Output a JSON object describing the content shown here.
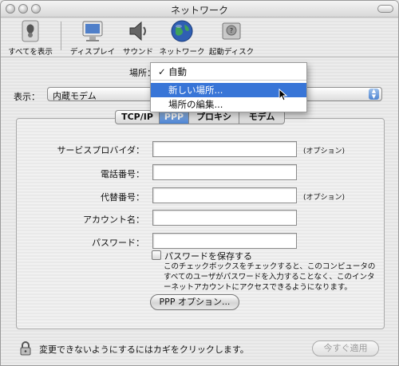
{
  "window": {
    "title": "ネットワーク"
  },
  "toolbar": {
    "items": [
      {
        "label": "すべてを表示",
        "icon": "show-all-icon"
      },
      {
        "label": "ディスプレイ",
        "icon": "display-icon"
      },
      {
        "label": "サウンド",
        "icon": "sound-icon"
      },
      {
        "label": "ネットワーク",
        "icon": "network-globe-icon"
      },
      {
        "label": "起動ディスク",
        "icon": "startup-disk-icon"
      }
    ]
  },
  "location": {
    "label": "場所：",
    "menu": {
      "current": "自動",
      "items": [
        "新しい場所...",
        "場所の編集..."
      ],
      "highlighted": "新しい場所..."
    }
  },
  "show": {
    "label": "表示：",
    "value": "内蔵モデム"
  },
  "tabs": [
    "TCP/IP",
    "PPP",
    "プロキシ",
    "モデム"
  ],
  "active_tab": "PPP",
  "form": {
    "fields": [
      {
        "label": "サービスプロバイダ：",
        "value": "",
        "hint": "(オプション)"
      },
      {
        "label": "電話番号：",
        "value": "",
        "hint": ""
      },
      {
        "label": "代替番号：",
        "value": "",
        "hint": "(オプション)"
      },
      {
        "label": "アカウント名：",
        "value": "",
        "hint": ""
      },
      {
        "label": "パスワード：",
        "value": "",
        "hint": ""
      }
    ],
    "save_password": {
      "label": "パスワードを保存する",
      "checked": false,
      "description": "このチェックボックスをチェックすると、このコンピュータのすべてのユーザがパスワードを入力することなく、このインターネットアカウントにアクセスできるようになります。"
    },
    "ppp_options_button": "PPP オプション..."
  },
  "footer": {
    "lock_text": "変更できないようにするにはカギをクリックします。",
    "apply_button": "今すぐ適用"
  },
  "colors": {
    "accent": "#3875d7",
    "tab_active": "#4c84d3"
  }
}
